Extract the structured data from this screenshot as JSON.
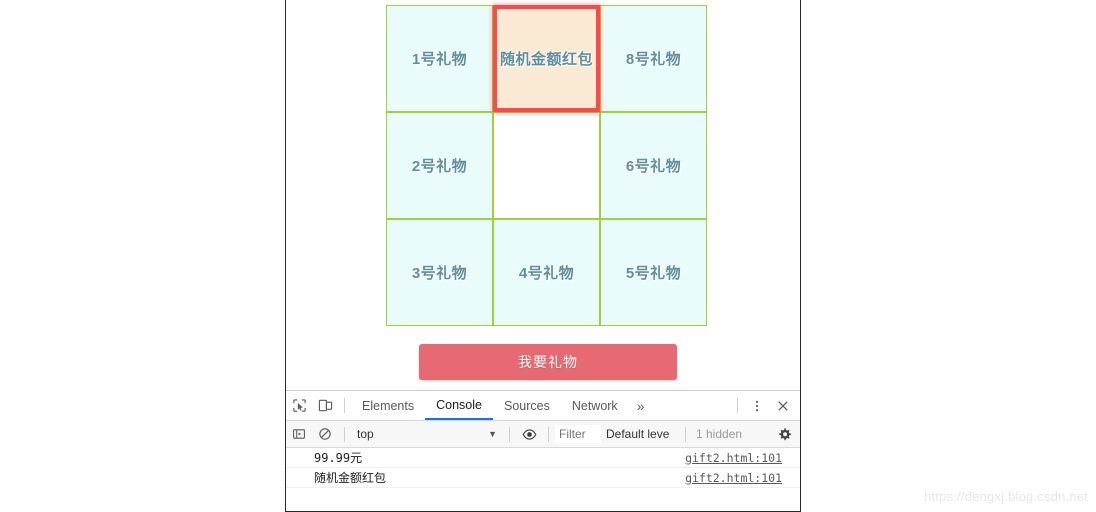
{
  "page": {
    "gifts": [
      {
        "label": "1号礼物",
        "state": "normal"
      },
      {
        "label": "随机金额红包",
        "state": "active"
      },
      {
        "label": "8号礼物",
        "state": "normal"
      },
      {
        "label": "2号礼物",
        "state": "normal"
      },
      {
        "label": "",
        "state": "empty"
      },
      {
        "label": "6号礼物",
        "state": "normal"
      },
      {
        "label": "3号礼物",
        "state": "normal"
      },
      {
        "label": "4号礼物",
        "state": "normal"
      },
      {
        "label": "5号礼物",
        "state": "normal"
      }
    ],
    "draw_button_label": "我要礼物",
    "colors": {
      "cell_bg": "#e9fcfb",
      "cell_border": "#9ed13a",
      "cell_text": "#5e8f9b",
      "active_bg": "#fae9d3",
      "active_border": "#fb4a4a",
      "button_bg": "#e76a72"
    }
  },
  "devtools": {
    "icons": {
      "inspect": "inspect-element-icon",
      "device": "device-toolbar-icon",
      "more_panels": "»",
      "menu": "⋮",
      "close": "✕",
      "sidebar": "console-sidebar-icon",
      "clear": "clear-console-icon",
      "eye": "live-expression-icon",
      "settings": "settings-gear-icon"
    },
    "tabs": [
      {
        "label": "Elements",
        "active": false
      },
      {
        "label": "Console",
        "active": true
      },
      {
        "label": "Sources",
        "active": false
      },
      {
        "label": "Network",
        "active": false
      }
    ],
    "filterbar": {
      "context": "top",
      "filter_placeholder": "Filter",
      "filter_value": "",
      "level": "Default leve",
      "hidden": "1 hidden"
    },
    "console": [
      {
        "text": "99.99元",
        "source": "gift2.html:101"
      },
      {
        "text": "随机金额红包",
        "source": "gift2.html:101"
      }
    ],
    "active_tab_underline_color": "#1a73e8"
  },
  "watermark": "https://dengxj.blog.csdn.net"
}
